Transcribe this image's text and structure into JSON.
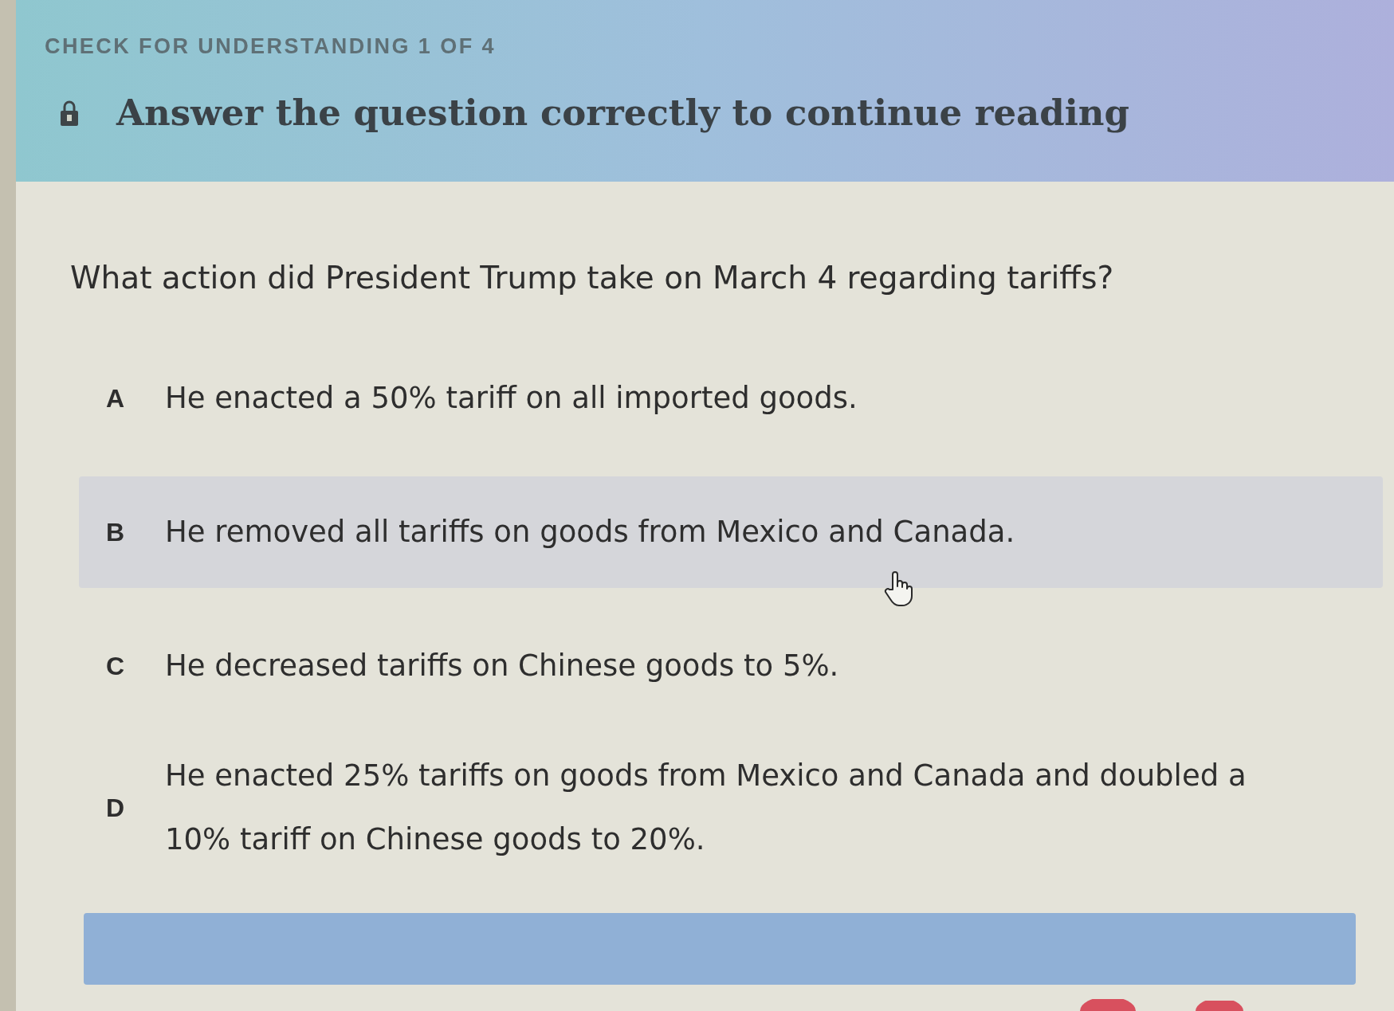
{
  "header": {
    "eyebrow": "CHECK FOR UNDERSTANDING 1 OF 4",
    "title": "Answer the question correctly to continue reading"
  },
  "question": "What action did President Trump take on March 4 regarding tariffs?",
  "options": [
    {
      "letter": "A",
      "text": "He enacted a 50% tariff on all imported goods.",
      "selected": false
    },
    {
      "letter": "B",
      "text": "He removed all tariffs on goods from Mexico and Canada.",
      "selected": true
    },
    {
      "letter": "C",
      "text": "He decreased tariffs on Chinese goods to 5%.",
      "selected": false
    },
    {
      "letter": "D",
      "text": "He enacted 25% tariffs on goods from Mexico and Canada and doubled a 10% tariff on Chinese goods to 20%.",
      "selected": false
    }
  ]
}
